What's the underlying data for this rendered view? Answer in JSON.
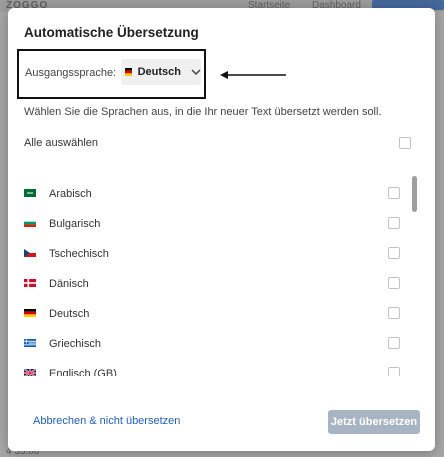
{
  "background": {
    "logo": "ZOGGO",
    "nav": [
      "Startseite",
      "Dashboard"
    ],
    "bottom_text": "4 35.00"
  },
  "modal": {
    "title": "Automatische Übersetzung",
    "source_language": {
      "label": "Ausgangssprache:",
      "value": "Deutsch",
      "flag": "de"
    },
    "hint": "Wählen Sie die Sprachen aus, in die Ihr neuer Text übersetzt werden soll.",
    "select_all_label": "Alle auswählen",
    "languages": [
      {
        "label": "Arabisch",
        "flag": "sa",
        "checked": false
      },
      {
        "label": "Bulgarisch",
        "flag": "bg",
        "checked": false
      },
      {
        "label": "Tschechisch",
        "flag": "cz",
        "checked": false
      },
      {
        "label": "Dänisch",
        "flag": "dk",
        "checked": false
      },
      {
        "label": "Deutsch",
        "flag": "de",
        "checked": false
      },
      {
        "label": "Griechisch",
        "flag": "gr",
        "checked": false
      },
      {
        "label": "Englisch (GB)",
        "flag": "gb",
        "checked": false
      }
    ],
    "cancel_label": "Abbrechen & nicht übersetzen",
    "submit_label": "Jetzt übersetzen"
  },
  "colors": {
    "link": "#1f5fbf",
    "submit_disabled": "#a7b4c4"
  }
}
